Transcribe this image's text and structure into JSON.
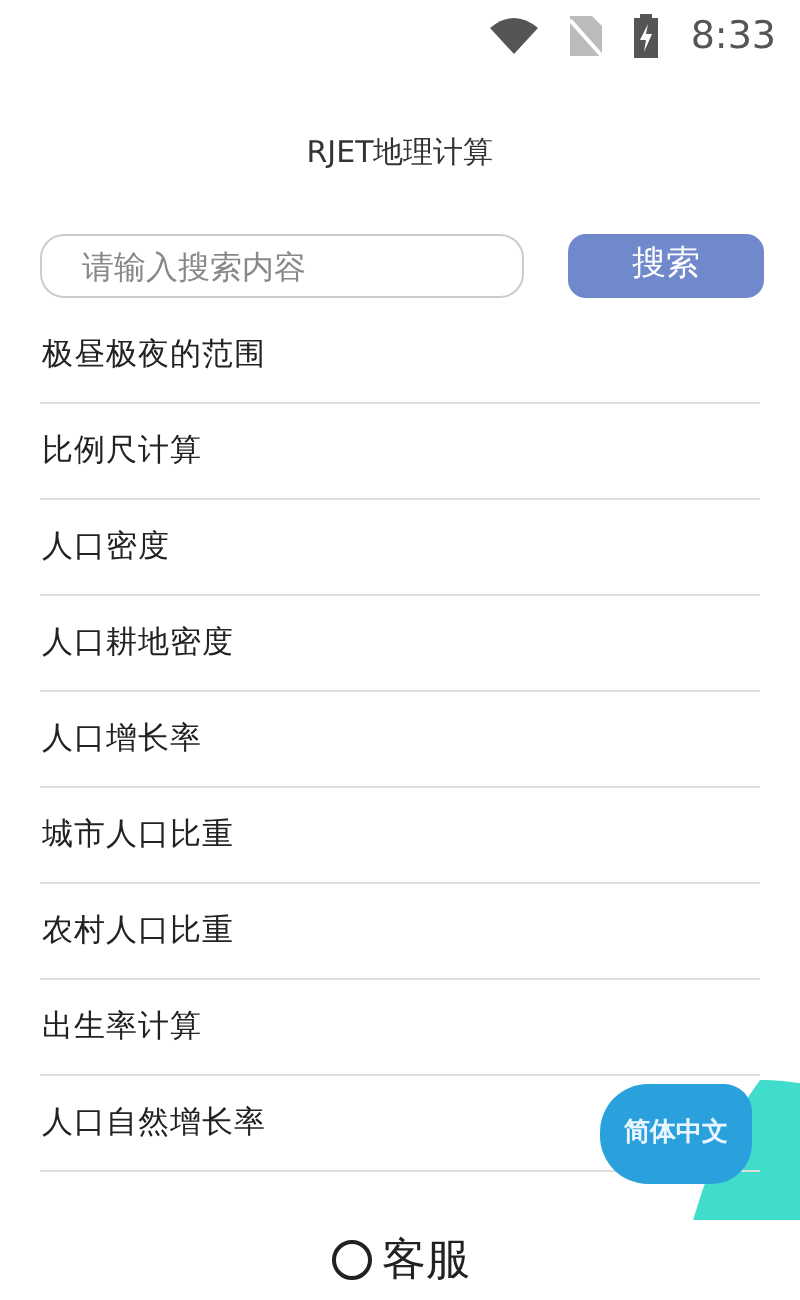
{
  "status_bar": {
    "time": "8:33"
  },
  "header": {
    "title": "RJET地理计算"
  },
  "search": {
    "placeholder": "请输入搜索内容",
    "button": "搜索"
  },
  "items": [
    {
      "label": "极昼极夜的范围"
    },
    {
      "label": "比例尺计算"
    },
    {
      "label": "人口密度"
    },
    {
      "label": "人口耕地密度"
    },
    {
      "label": "人口增长率"
    },
    {
      "label": "城市人口比重"
    },
    {
      "label": "农村人口比重"
    },
    {
      "label": "出生率计算"
    },
    {
      "label": "人口自然增长率"
    }
  ],
  "language_button": "简体中文",
  "footer": {
    "label": "客服"
  }
}
